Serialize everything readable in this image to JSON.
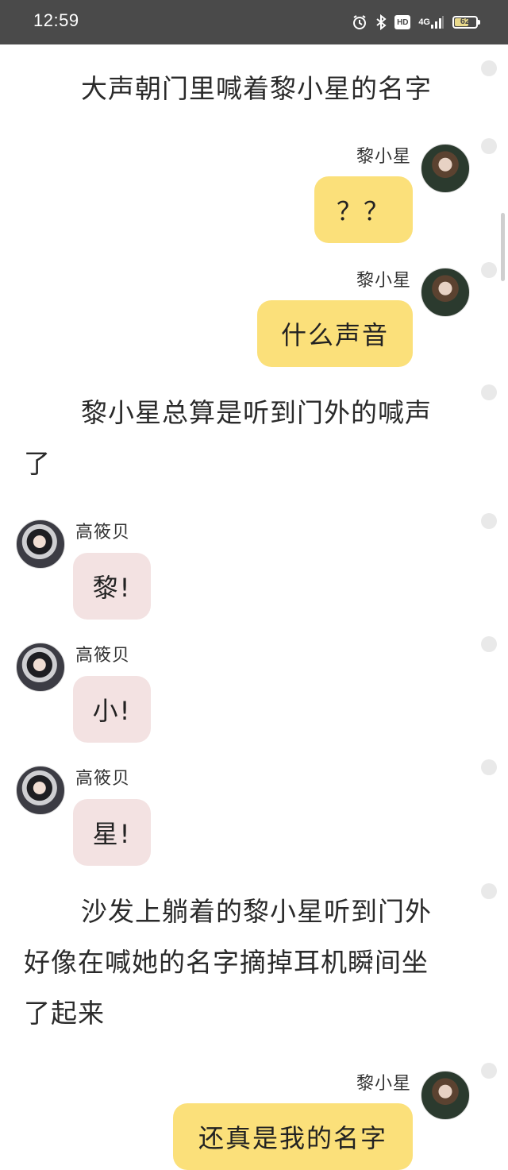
{
  "status_bar": {
    "time": "12:59",
    "network": "4G",
    "hd": "HD",
    "battery": "62"
  },
  "messages": [
    {
      "type": "narration",
      "text": "大声朝门里喊着黎小星的名字"
    },
    {
      "type": "chat",
      "side": "right",
      "sender": "黎小星",
      "text": "？？"
    },
    {
      "type": "chat",
      "side": "right",
      "sender": "黎小星",
      "text": "什么声音"
    },
    {
      "type": "narration",
      "text": "黎小星总算是听到门外的喊声了"
    },
    {
      "type": "chat",
      "side": "left",
      "sender": "高筱贝",
      "text": "黎!"
    },
    {
      "type": "chat",
      "side": "left",
      "sender": "高筱贝",
      "text": "小!"
    },
    {
      "type": "chat",
      "side": "left",
      "sender": "高筱贝",
      "text": "星!"
    },
    {
      "type": "narration",
      "text": "沙发上躺着的黎小星听到门外好像在喊她的名字摘掉耳机瞬间坐了起来"
    },
    {
      "type": "chat",
      "side": "right",
      "sender": "黎小星",
      "text": "还真是我的名字"
    }
  ]
}
